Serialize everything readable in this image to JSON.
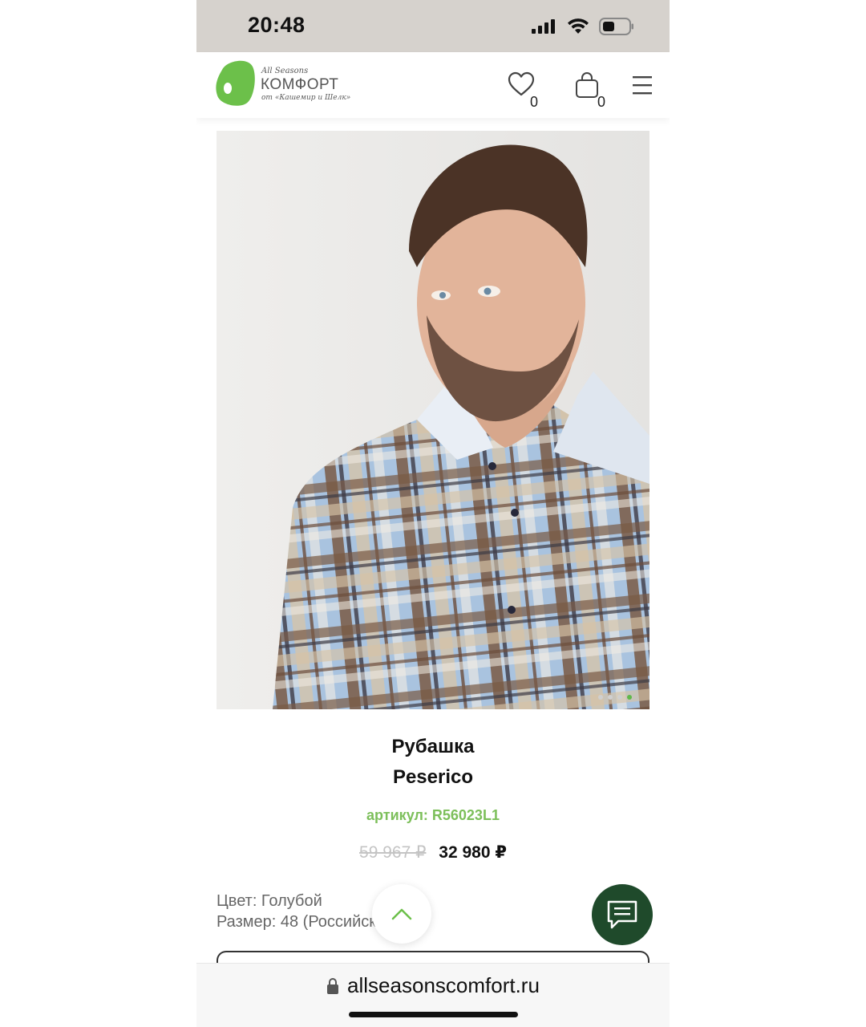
{
  "status_bar": {
    "time": "20:48"
  },
  "header": {
    "logo": {
      "top_text": "All Seasons",
      "main_text": "КОМФОРТ",
      "sub_text": "от «Кашемир и Шелк»"
    },
    "favorites_count": "0",
    "cart_count": "0",
    "icons": [
      "heart-icon",
      "bag-icon",
      "menu-icon"
    ]
  },
  "product": {
    "title_line1": "Рубашка",
    "title_line2": "Peserico",
    "sku": "артикул: R56023L1",
    "old_price": "59 967 ₽",
    "new_price": "32 980 ₽",
    "color": "Цвет: Голубой",
    "size": "Размер: 48 (Российский 48)",
    "gallery_dots": 4,
    "gallery_active_index": 3
  },
  "browser": {
    "url": "allseasonscomfort.ru"
  },
  "colors": {
    "brand_green": "#6cc04a",
    "sku_green": "#7cbf5a",
    "chat_button": "#1f4a2b",
    "status_bar_bg": "#d6d2cd"
  }
}
